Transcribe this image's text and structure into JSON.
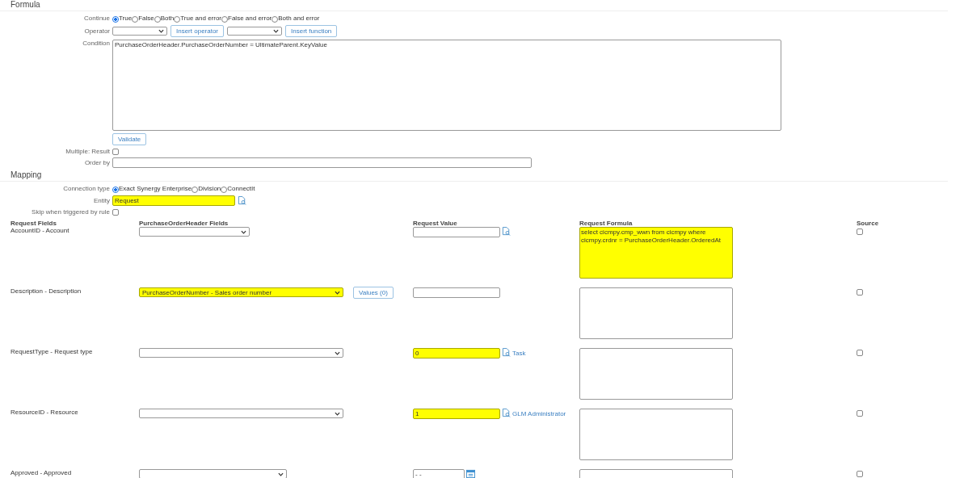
{
  "formula": {
    "title": "Formula",
    "continue": {
      "label": "Continue",
      "options": [
        {
          "label": "True",
          "selected": true
        },
        {
          "label": "False",
          "selected": false
        },
        {
          "label": "Both",
          "selected": false
        },
        {
          "label": "True and error",
          "selected": false
        },
        {
          "label": "False and error",
          "selected": false
        },
        {
          "label": "Both and error",
          "selected": false
        }
      ]
    },
    "operator": {
      "label": "Operator",
      "buttons": [
        "Insert operator",
        "Insert function"
      ]
    },
    "condition": {
      "label": "Condition",
      "value": "PurchaseOrderHeader.PurchaseOrderNumber = UltimateParent.KeyValue"
    },
    "validate_button": "Validate",
    "multiple_result": {
      "label": "Multiple: Result",
      "checked": false
    },
    "order_by": {
      "label": "Order by"
    }
  },
  "mapping": {
    "title": "Mapping",
    "connection_type": {
      "label": "Connection type",
      "options": [
        {
          "label": "Exact Synergy Enterprise",
          "selected": true
        },
        {
          "label": "Division",
          "selected": false
        },
        {
          "label": "ConnectIt",
          "selected": false
        }
      ]
    },
    "entity": {
      "label": "Entity",
      "value": "Request",
      "highlighted": true
    },
    "skip_when_triggered": {
      "label": "Skip when triggered by rule",
      "checked": false
    },
    "table": {
      "columns": [
        "Request Fields",
        "PurchaseOrderHeader Fields",
        "Request Value",
        "Request Formula",
        "Source"
      ],
      "rows": [
        {
          "field": "AccountID - Account",
          "header_field": {
            "highlighted": false
          },
          "request_value": {
            "kind": "lookup",
            "highlighted": false
          },
          "request_formula": {
            "value": "select cicmpy.cmp_wwn from cicmpy where cicmpy.crdnr = PurchaseOrderHeader.OrderedAt",
            "highlighted": true
          },
          "source_checked": false
        },
        {
          "field": "Description - Description",
          "header_field": {
            "value": "PurchaseOrderNumber - Sales order number",
            "highlighted": true
          },
          "values_button": "Values (0)",
          "request_value": {
            "kind": "text",
            "highlighted": false
          },
          "request_formula": {
            "highlighted": false
          },
          "source_checked": false
        },
        {
          "field": "RequestType - Request type",
          "header_field": {
            "highlighted": false
          },
          "request_value": {
            "kind": "lookup",
            "value": "0",
            "link": "Task",
            "highlighted": true
          },
          "request_formula": {
            "highlighted": false
          },
          "source_checked": false
        },
        {
          "field": "ResourceID - Resource",
          "header_field": {
            "highlighted": false
          },
          "request_value": {
            "kind": "lookup",
            "value": "1",
            "link": "GLM Administrator",
            "highlighted": true
          },
          "request_formula": {
            "highlighted": false
          },
          "source_checked": false
        },
        {
          "field": "Approved - Approved",
          "header_field": {
            "highlighted": false
          },
          "request_value": {
            "kind": "date",
            "value": "- -",
            "highlighted": false
          },
          "request_formula": {
            "highlighted": false
          },
          "source_checked": false
        }
      ]
    }
  }
}
